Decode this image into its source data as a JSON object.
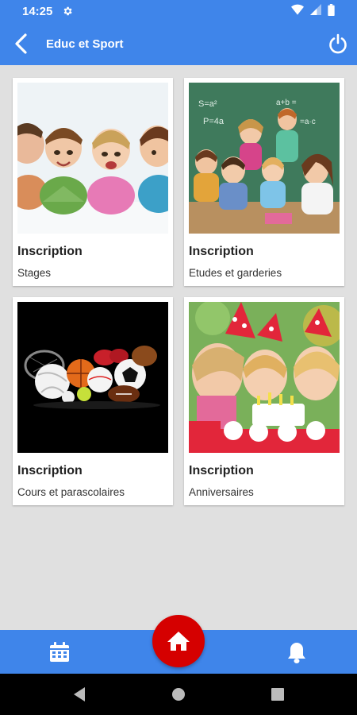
{
  "status_bar": {
    "time": "14:25"
  },
  "app_bar": {
    "title": "Educ et Sport"
  },
  "cards": [
    {
      "title": "Inscription",
      "subtitle": "Stages",
      "image": "children-lying-photo"
    },
    {
      "title": "Inscription",
      "subtitle": "Etudes et garderies",
      "image": "classroom-children-photo"
    },
    {
      "title": "Inscription",
      "subtitle": "Cours et parascolaires",
      "image": "sports-balls-photo"
    },
    {
      "title": "Inscription",
      "subtitle": "Anniversaires",
      "image": "birthday-cake-photo"
    }
  ],
  "bottom_nav": {
    "items": [
      "calendar-icon",
      "home-icon",
      "bell-icon"
    ]
  },
  "colors": {
    "primary": "#3f85ea",
    "home_button": "#d50000",
    "background": "#e0e0e0"
  }
}
